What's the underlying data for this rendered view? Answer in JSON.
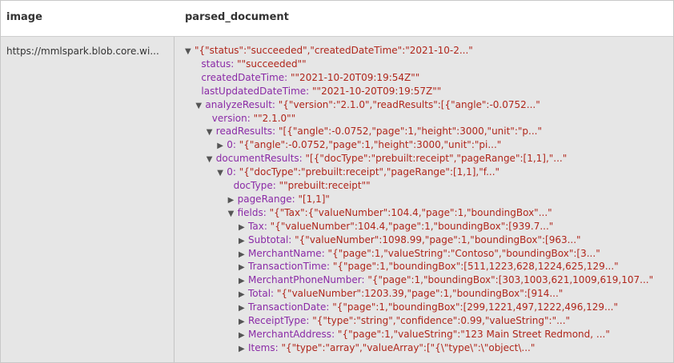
{
  "columns": {
    "image": "image",
    "parsed_document": "parsed_document"
  },
  "image_url": "https://mmlspark.blob.core.wi...",
  "toggles": {
    "expanded": "▼",
    "collapsed": "▶"
  },
  "tree": [
    {
      "indent": 0,
      "toggle": "expanded",
      "key": "",
      "value": "\"{\"status\":\"succeeded\",\"createdDateTime\":\"2021-10-2...\""
    },
    {
      "indent": 1,
      "toggle": "none",
      "key": "status",
      "value": "\"\"succeeded\"\""
    },
    {
      "indent": 1,
      "toggle": "none",
      "key": "createdDateTime",
      "value": "\"\"2021-10-20T09:19:54Z\"\""
    },
    {
      "indent": 1,
      "toggle": "none",
      "key": "lastUpdatedDateTime",
      "value": "\"\"2021-10-20T09:19:57Z\"\""
    },
    {
      "indent": 1,
      "toggle": "expanded",
      "key": "analyzeResult",
      "value": "\"{\"version\":\"2.1.0\",\"readResults\":[{\"angle\":-0.0752...\""
    },
    {
      "indent": 2,
      "toggle": "none",
      "key": "version",
      "value": "\"\"2.1.0\"\""
    },
    {
      "indent": 2,
      "toggle": "expanded",
      "key": "readResults",
      "value": "\"[{\"angle\":-0.0752,\"page\":1,\"height\":3000,\"unit\":\"p...\""
    },
    {
      "indent": 3,
      "toggle": "collapsed",
      "key": "0",
      "value": "\"{\"angle\":-0.0752,\"page\":1,\"height\":3000,\"unit\":\"pi...\""
    },
    {
      "indent": 2,
      "toggle": "expanded",
      "key": "documentResults",
      "value": "\"[{\"docType\":\"prebuilt:receipt\",\"pageRange\":[1,1],\"...\""
    },
    {
      "indent": 3,
      "toggle": "expanded",
      "key": "0",
      "value": "\"{\"docType\":\"prebuilt:receipt\",\"pageRange\":[1,1],\"f...\""
    },
    {
      "indent": 4,
      "toggle": "none",
      "key": "docType",
      "value": "\"\"prebuilt:receipt\"\""
    },
    {
      "indent": 4,
      "toggle": "collapsed",
      "key": "pageRange",
      "value": "\"[1,1]\""
    },
    {
      "indent": 4,
      "toggle": "expanded",
      "key": "fields",
      "value": "\"{\"Tax\":{\"valueNumber\":104.4,\"page\":1,\"boundingBox\"...\""
    },
    {
      "indent": 5,
      "toggle": "collapsed",
      "key": "Tax",
      "value": "\"{\"valueNumber\":104.4,\"page\":1,\"boundingBox\":[939.7...\""
    },
    {
      "indent": 5,
      "toggle": "collapsed",
      "key": "Subtotal",
      "value": "\"{\"valueNumber\":1098.99,\"page\":1,\"boundingBox\":[963...\""
    },
    {
      "indent": 5,
      "toggle": "collapsed",
      "key": "MerchantName",
      "value": "\"{\"page\":1,\"valueString\":\"Contoso\",\"boundingBox\":[3...\""
    },
    {
      "indent": 5,
      "toggle": "collapsed",
      "key": "TransactionTime",
      "value": "\"{\"page\":1,\"boundingBox\":[511,1223,628,1224,625,129...\""
    },
    {
      "indent": 5,
      "toggle": "collapsed",
      "key": "MerchantPhoneNumber",
      "value": "\"{\"page\":1,\"boundingBox\":[303,1003,621,1009,619,107...\""
    },
    {
      "indent": 5,
      "toggle": "collapsed",
      "key": "Total",
      "value": "\"{\"valueNumber\":1203.39,\"page\":1,\"boundingBox\":[914...\""
    },
    {
      "indent": 5,
      "toggle": "collapsed",
      "key": "TransactionDate",
      "value": "\"{\"page\":1,\"boundingBox\":[299,1221,497,1222,496,129...\""
    },
    {
      "indent": 5,
      "toggle": "collapsed",
      "key": "ReceiptType",
      "value": "\"{\"type\":\"string\",\"confidence\":0.99,\"valueString\":\"...\""
    },
    {
      "indent": 5,
      "toggle": "collapsed",
      "key": "MerchantAddress",
      "value": "\"{\"page\":1,\"valueString\":\"123 Main Street Redmond, ...\""
    },
    {
      "indent": 5,
      "toggle": "collapsed",
      "key": "Items",
      "value": "\"{\"type\":\"array\",\"valueArray\":[\"{\\\"type\\\":\\\"object\\...\""
    }
  ]
}
